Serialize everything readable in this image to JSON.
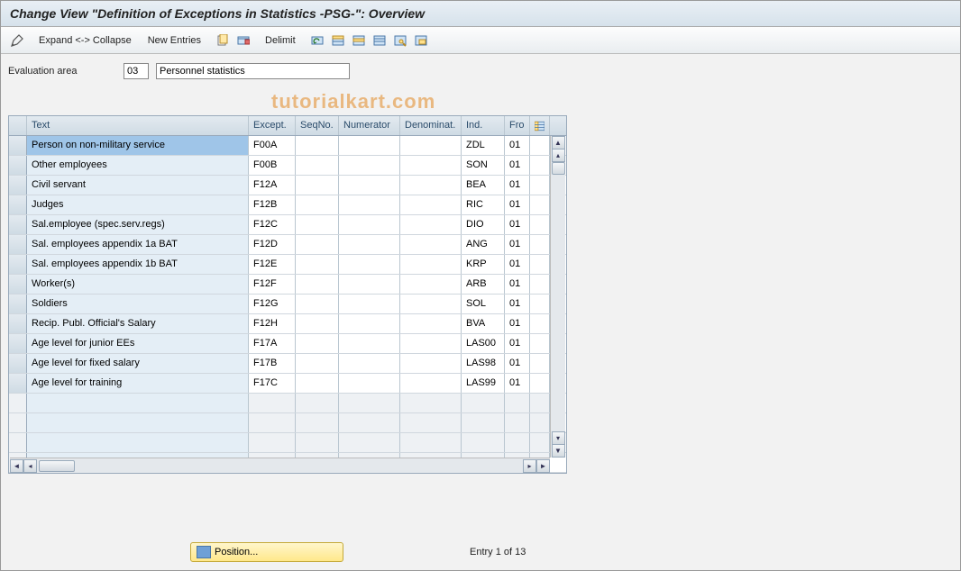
{
  "title": "Change View \"Definition of Exceptions in Statistics -PSG-\": Overview",
  "toolbar": {
    "expand_collapse": "Expand <-> Collapse",
    "new_entries": "New Entries",
    "delimit": "Delimit"
  },
  "fields": {
    "eval_area_label": "Evaluation area",
    "eval_area_code": "03",
    "eval_area_text": "Personnel statistics"
  },
  "table": {
    "headers": {
      "text": "Text",
      "except": "Except.",
      "seqno": "SeqNo.",
      "numerator": "Numerator",
      "denominat": "Denominat.",
      "ind": "Ind.",
      "from": "Fro"
    },
    "rows": [
      {
        "text": "Person on non-military service",
        "except": "F00A",
        "seqno": "",
        "numerator": "",
        "denominat": "",
        "ind": "ZDL",
        "from": "01",
        "selected": true
      },
      {
        "text": "Other employees",
        "except": "F00B",
        "seqno": "",
        "numerator": "",
        "denominat": "",
        "ind": "SON",
        "from": "01"
      },
      {
        "text": "Civil servant",
        "except": "F12A",
        "seqno": "",
        "numerator": "",
        "denominat": "",
        "ind": "BEA",
        "from": "01"
      },
      {
        "text": "Judges",
        "except": "F12B",
        "seqno": "",
        "numerator": "",
        "denominat": "",
        "ind": "RIC",
        "from": "01"
      },
      {
        "text": "Sal.employee (spec.serv.regs)",
        "except": "F12C",
        "seqno": "",
        "numerator": "",
        "denominat": "",
        "ind": "DIO",
        "from": "01"
      },
      {
        "text": "Sal. employees appendix 1a BAT",
        "except": "F12D",
        "seqno": "",
        "numerator": "",
        "denominat": "",
        "ind": "ANG",
        "from": "01"
      },
      {
        "text": "Sal. employees appendix 1b BAT",
        "except": "F12E",
        "seqno": "",
        "numerator": "",
        "denominat": "",
        "ind": "KRP",
        "from": "01"
      },
      {
        "text": "Worker(s)",
        "except": "F12F",
        "seqno": "",
        "numerator": "",
        "denominat": "",
        "ind": "ARB",
        "from": "01"
      },
      {
        "text": "Soldiers",
        "except": "F12G",
        "seqno": "",
        "numerator": "",
        "denominat": "",
        "ind": "SOL",
        "from": "01"
      },
      {
        "text": "Recip. Publ. Official's Salary",
        "except": "F12H",
        "seqno": "",
        "numerator": "",
        "denominat": "",
        "ind": "BVA",
        "from": "01"
      },
      {
        "text": "Age level for junior EEs",
        "except": "F17A",
        "seqno": "",
        "numerator": "",
        "denominat": "",
        "ind": "LAS00",
        "from": "01"
      },
      {
        "text": "Age level for fixed salary",
        "except": "F17B",
        "seqno": "",
        "numerator": "",
        "denominat": "",
        "ind": "LAS98",
        "from": "01"
      },
      {
        "text": "Age level for training",
        "except": "F17C",
        "seqno": "",
        "numerator": "",
        "denominat": "",
        "ind": "LAS99",
        "from": "01"
      }
    ],
    "empty_rows": 4
  },
  "footer": {
    "position_label": "Position...",
    "entry_text": "Entry 1 of 13"
  }
}
